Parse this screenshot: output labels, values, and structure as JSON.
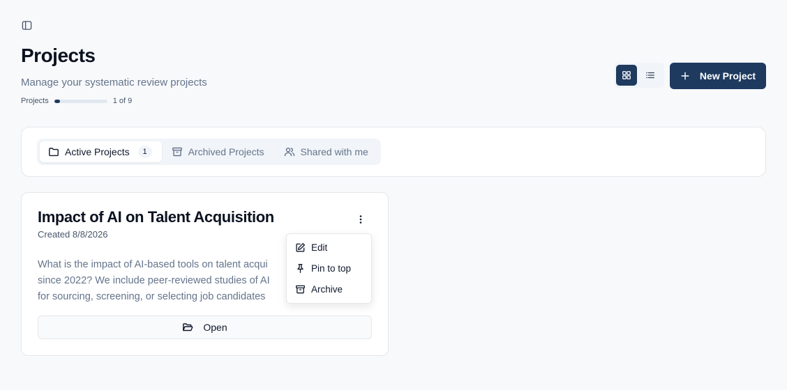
{
  "header": {
    "title": "Projects",
    "subtitle": "Manage your systematic review projects",
    "progress": {
      "label": "Projects",
      "text": "1 of 9",
      "used": 1,
      "total": 9
    }
  },
  "toolbar": {
    "view_modes": [
      "grid",
      "list"
    ],
    "active_view": "grid",
    "new_project_label": "New Project"
  },
  "tabs": [
    {
      "label": "Active Projects",
      "count": "1",
      "icon": "folder-icon",
      "active": true
    },
    {
      "label": "Archived Projects",
      "icon": "archive-icon",
      "active": false
    },
    {
      "label": "Shared with me",
      "icon": "users-icon",
      "active": false
    }
  ],
  "project": {
    "title": "Impact of AI on Talent Acquisition",
    "created": "Created 8/8/2026",
    "description_lines": [
      "What is the impact of AI-based tools on talent acqui",
      "since 2022? We include peer-reviewed studies of AI",
      "for sourcing, screening, or selecting job candidates"
    ],
    "open_label": "Open"
  },
  "menu": {
    "items": [
      {
        "label": "Edit",
        "icon": "edit-icon"
      },
      {
        "label": "Pin to top",
        "icon": "pin-icon"
      },
      {
        "label": "Archive",
        "icon": "archive-icon"
      }
    ]
  },
  "colors": {
    "accent": "#1e3a5f",
    "background": "#f8f9fb",
    "muted_text": "#64748b",
    "border": "#e5e7eb"
  }
}
